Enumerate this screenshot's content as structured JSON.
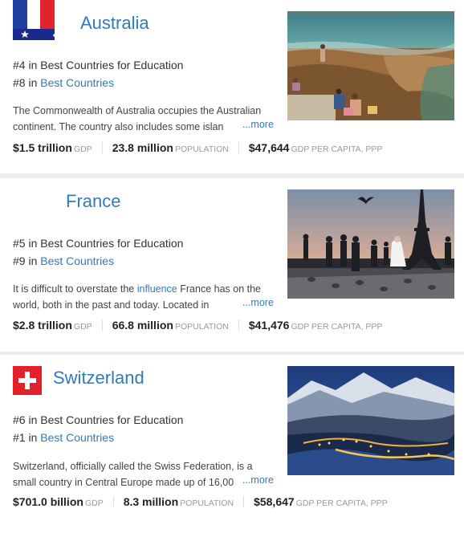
{
  "countries": [
    {
      "name": "Australia",
      "rank1": {
        "prefix": "#4 in ",
        "link": "Best Countries for Education"
      },
      "rank2": {
        "prefix": "#8 in ",
        "link": "Best Countries"
      },
      "desc_line1": "The Commonwealth of Australia occupies the Australian",
      "desc_line2": "continent. The country also includes some islan",
      "more": "...more",
      "gdp": "$1.5 trillion",
      "gdp_label": "GDP",
      "pop": "23.8 million",
      "pop_label": "POPULATION",
      "gdppc": "$47,644",
      "gdppc_label": "GDP PER CAPITA, PPP"
    },
    {
      "name": "France",
      "rank1": {
        "prefix": "#5 in ",
        "link": "Best Countries for Education"
      },
      "rank2": {
        "prefix": "#9 in ",
        "link": "Best Countries"
      },
      "desc_line1_a": "It is difficult to overstate the ",
      "desc_line1_link": "influence",
      "desc_line1_b": " France has on the",
      "desc_line2": "world, both in the past and today. Located in",
      "more": "...more",
      "gdp": "$2.8 trillion",
      "gdp_label": "GDP",
      "pop": "66.8 million",
      "pop_label": "POPULATION",
      "gdppc": "$41,476",
      "gdppc_label": "GDP PER CAPITA, PPP"
    },
    {
      "name": "Switzerland",
      "rank1": {
        "prefix": "#6 in ",
        "link": "Best Countries for Education"
      },
      "rank2": {
        "prefix": "#1 in ",
        "link": "Best Countries"
      },
      "desc_line1": "Switzerland, officially called the Swiss Federation, is a",
      "desc_line2": "small country in Central Europe made up of 16,00",
      "more": "...more",
      "gdp": "$701.0 billion",
      "gdp_label": "GDP",
      "pop": "8.3 million",
      "pop_label": "POPULATION",
      "gdppc": "$58,647",
      "gdppc_label": "GDP PER CAPITA, PPP"
    }
  ]
}
